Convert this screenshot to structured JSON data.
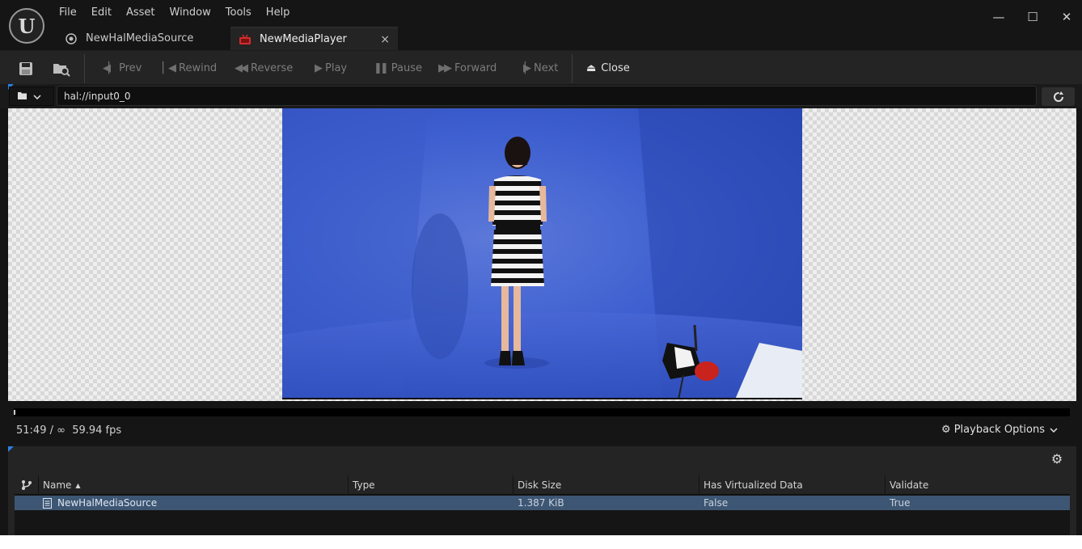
{
  "menu": [
    "File",
    "Edit",
    "Asset",
    "Window",
    "Tools",
    "Help"
  ],
  "logo": "U",
  "window_controls": {
    "minimize": "—",
    "maximize": "☐",
    "close": "✕"
  },
  "tabs": [
    {
      "label": "NewHalMediaSource",
      "active": false
    },
    {
      "label": "NewMediaPlayer",
      "active": true,
      "close": "×"
    }
  ],
  "toolbar": {
    "prev": "Prev",
    "rewind": "Rewind",
    "reverse": "Reverse",
    "play": "Play",
    "pause": "Pause",
    "forward": "Forward",
    "next": "Next",
    "close": "Close"
  },
  "url": {
    "value": "hal://input0_0"
  },
  "status": {
    "time": "51:49 / ∞",
    "fps": "59.94 fps"
  },
  "playback_options": "Playback Options",
  "table": {
    "columns": [
      "Name",
      "Type",
      "Disk Size",
      "Has Virtualized Data",
      "Validate"
    ],
    "sort_indicator": "▲",
    "rows": [
      {
        "name": "NewHalMediaSource",
        "type": "",
        "disk_size": "1.387 KiB",
        "has_virtualized_data": "False",
        "validate": "True"
      }
    ]
  },
  "colors": {
    "accent": "#2a7fe0",
    "selected_row": "#3d5673",
    "video_blue": "#3f60d0"
  }
}
